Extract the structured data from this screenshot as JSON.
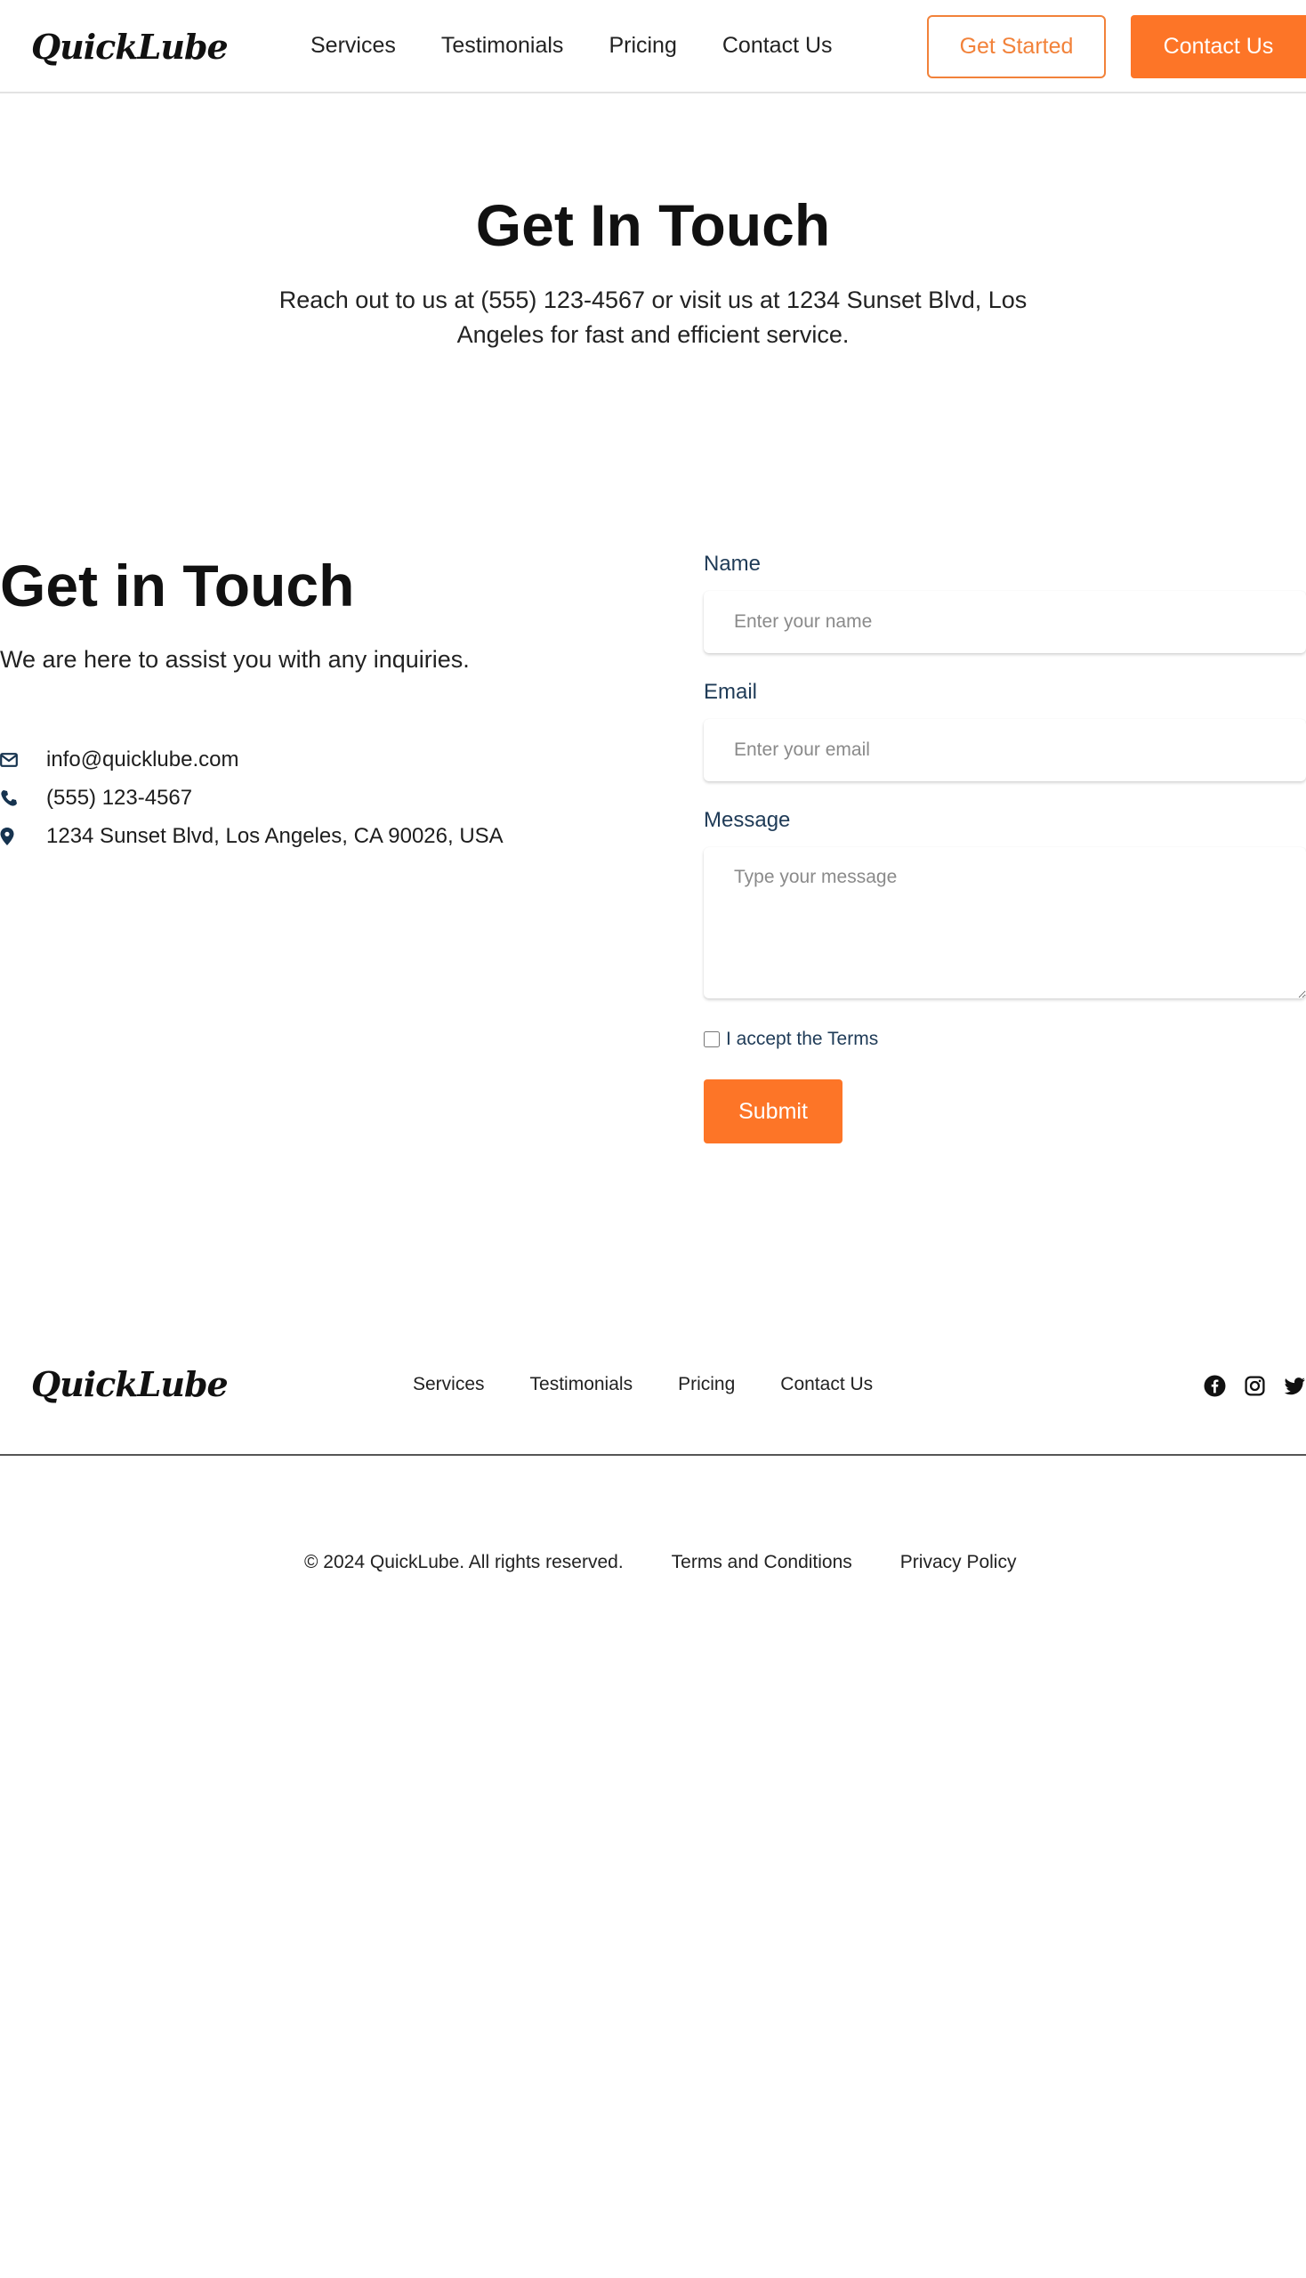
{
  "brand": {
    "logo": "QuickLube"
  },
  "header": {
    "nav": [
      "Services",
      "Testimonials",
      "Pricing",
      "Contact Us"
    ],
    "get_started": "Get Started",
    "contact_us": "Contact Us"
  },
  "hero": {
    "title": "Get In Touch",
    "subtitle": "Reach out to us at (555) 123-4567 or visit us at 1234 Sunset Blvd, Los Angeles for fast and efficient service."
  },
  "contact": {
    "title": "Get in Touch",
    "subtitle": "We are here to assist you with any inquiries.",
    "items": [
      {
        "icon": "envelope-icon",
        "text": "info@quicklube.com"
      },
      {
        "icon": "phone-icon",
        "text": "(555) 123-4567"
      },
      {
        "icon": "map-pin-icon",
        "text": "1234 Sunset Blvd, Los Angeles, CA 90026, USA"
      }
    ]
  },
  "form": {
    "name_label": "Name",
    "name_placeholder": "Enter your name",
    "email_label": "Email",
    "email_placeholder": "Enter your email",
    "message_label": "Message",
    "message_placeholder": "Type your message",
    "terms_label": "I accept the Terms",
    "terms_checked": false,
    "submit_label": "Submit"
  },
  "footer": {
    "nav": [
      "Services",
      "Testimonials",
      "Pricing",
      "Contact Us"
    ],
    "social": [
      "facebook-icon",
      "instagram-icon",
      "twitter-icon"
    ],
    "copyright": "© 2024 QuickLube. All rights reserved.",
    "terms": "Terms and Conditions",
    "privacy": "Privacy Policy"
  },
  "colors": {
    "accent": "#fd7527",
    "accent_outline": "#f2823a",
    "label": "#1f3b57",
    "icon": "#16334f"
  }
}
